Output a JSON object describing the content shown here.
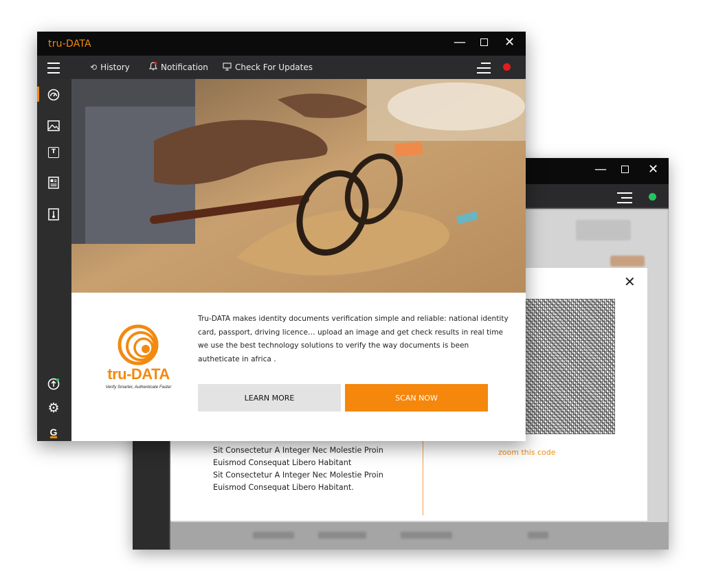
{
  "app": {
    "title": "tru-DATA"
  },
  "window_controls": {
    "minimize": "—",
    "maximize": "",
    "close": "✕"
  },
  "toolbar": {
    "history": "History",
    "notification": "Notification",
    "check_updates": "Check For Updates",
    "history_icon": "⟲",
    "notification_icon": "🔔",
    "updates_icon": "🖵"
  },
  "status": {
    "front_color": "#e11d1d",
    "back_color": "#22c55e"
  },
  "sidebar": {
    "items": [
      {
        "icon": "speedometer-icon",
        "glyph": "◔"
      },
      {
        "icon": "image-icon",
        "glyph": "⛰"
      },
      {
        "icon": "text-icon",
        "glyph": "T"
      },
      {
        "icon": "document-icon",
        "glyph": "▤"
      },
      {
        "icon": "thermometer-icon",
        "glyph": "ℹ"
      }
    ],
    "bottom": [
      {
        "icon": "upload-icon",
        "glyph": "⬆"
      },
      {
        "icon": "settings-icon",
        "glyph": "⚙"
      },
      {
        "icon": "g-logo-icon",
        "glyph": "G"
      }
    ]
  },
  "hero": {
    "alt": "desk-photo"
  },
  "logo": {
    "name": "tru-DATA",
    "tagline": "Verify Smarter, Authenticate Faster"
  },
  "description": {
    "lines": [
      "Tru-DATA makes identity documents verification simple and reliable: national identity",
      "card, passport, driving licence… upload an image and get check results in real time",
      "we use the best technology solutions to  verify  the way  documents is been",
      "autheticate in africa ."
    ]
  },
  "buttons": {
    "learn_more": "LEARN MORE",
    "scan_now": "SCAN NOW"
  },
  "modal": {
    "close": "✕",
    "zoom_link": "zoom this code",
    "lines": [
      "Sit Consectetur A Integer Nec Molestie Proin",
      "Euismod Consequat Libero Habitant",
      "Sit Consectetur A Integer Nec Molestie Proin",
      "Euismod Consequat Libero Habitant."
    ]
  },
  "colors": {
    "accent": "#f28a10",
    "titlebar": "#0b0b0b",
    "toolbar": "#2b2b2d"
  }
}
